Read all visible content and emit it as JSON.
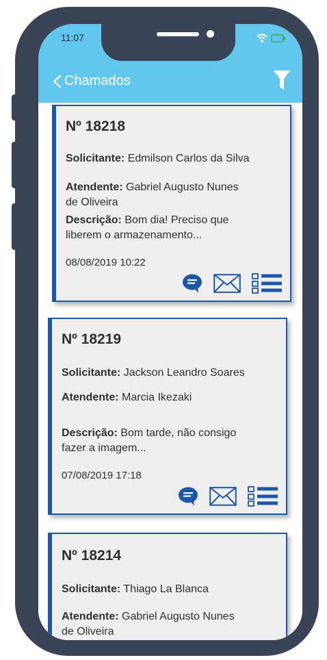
{
  "status_bar": {
    "time": "11:07"
  },
  "header": {
    "back_label": "Chamados"
  },
  "labels": {
    "solicitante": "Solicitante:",
    "atendente": "Atendente:",
    "descricao": "Descrição:"
  },
  "tickets": [
    {
      "number": "Nº 18218",
      "solicitante": "Edmilson Carlos da Silva",
      "atendente_l1": "Gabriel Augusto Nunes",
      "atendente_l2": "de Oliveira",
      "descricao_l1": "Bom dia! Preciso que",
      "descricao_l2": "liberem o armazenamento...",
      "date": "08/08/2019 10:22"
    },
    {
      "number": "Nº 18219",
      "solicitante": "Jackson Leandro Soares",
      "atendente_l1": "Marcia Ikezaki",
      "descricao_l1": "Bom tarde, não consigo",
      "descricao_l2": "fazer a imagem...",
      "date": "07/08/2019 17:18"
    },
    {
      "number": "Nº 18214",
      "solicitante": "Thiago La Blanca",
      "atendente_l1": "Gabriel Augusto Nunes",
      "atendente_l2": "de Oliveira"
    }
  ],
  "colors": {
    "topbar": "#62c6ee",
    "accent": "#1e56a6",
    "frame": "#3b4457",
    "card": "#eeeeee"
  },
  "icons": [
    "back-chevron-icon",
    "filter-icon",
    "wifi-icon",
    "battery-icon",
    "chat-icon",
    "mail-icon",
    "list-icon"
  ]
}
